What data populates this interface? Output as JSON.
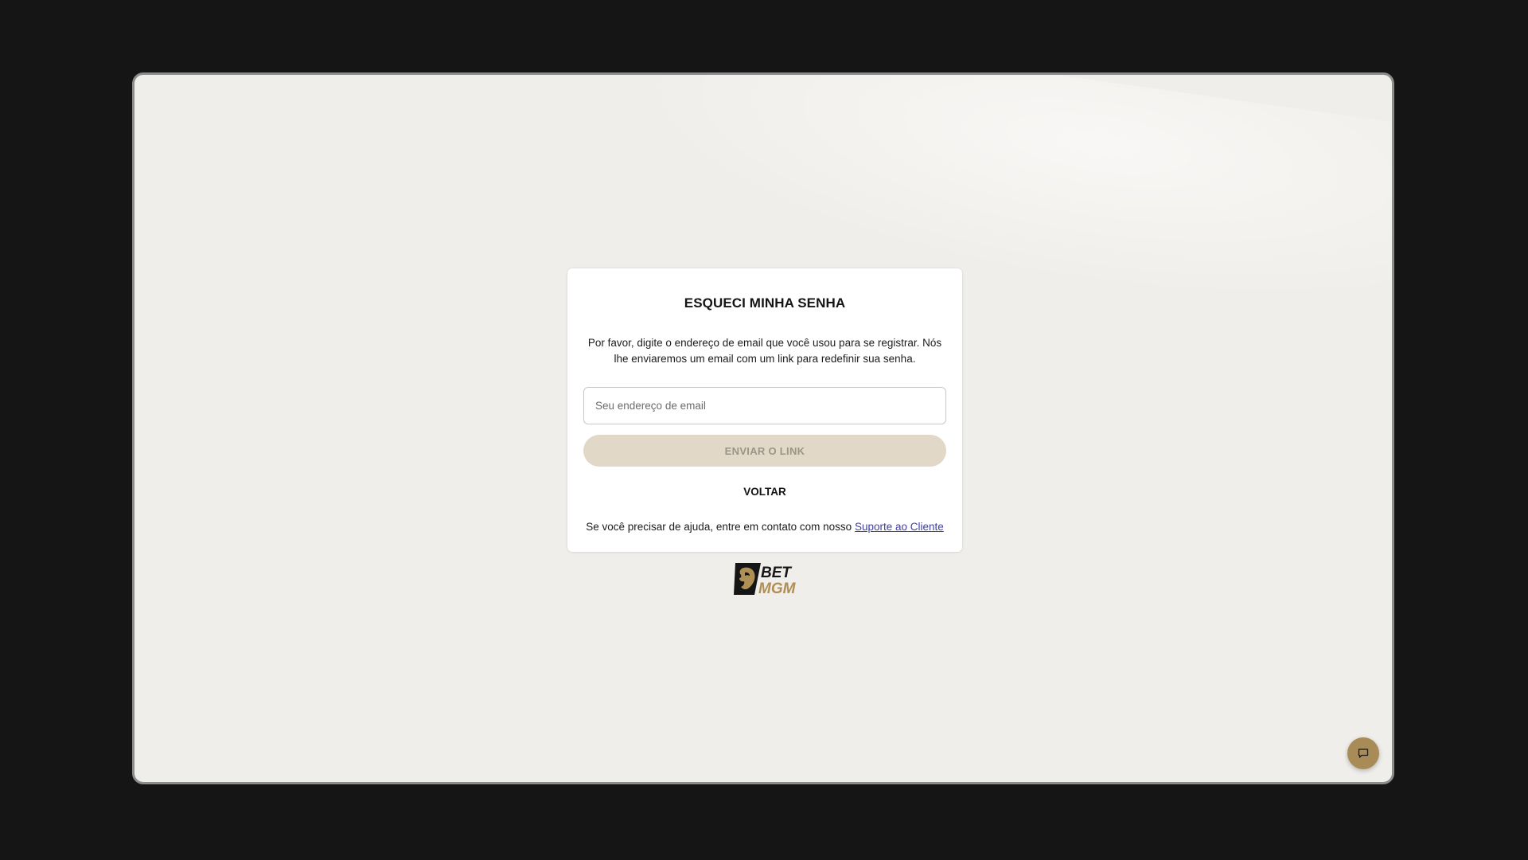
{
  "forgot_password": {
    "title": "ESQUECI MINHA SENHA",
    "description": "Por favor, digite o endereço de email que você usou para se registrar. Nós lhe enviaremos um email com um link para redefinir sua senha.",
    "email_field": {
      "placeholder": "Seu endereço de email",
      "value": ""
    },
    "send_button_label": "ENVIAR O LINK",
    "back_label": "VOLTAR",
    "help_text": "Se você precisar de ajuda, entre em contato com nosso",
    "support_link_label": "Suporte ao Cliente"
  },
  "brand": {
    "logo_text_top": "BET",
    "logo_text_bottom": "MGM",
    "logo_icon": "lion-icon"
  },
  "chat": {
    "icon": "chat-bubble-icon"
  },
  "colors": {
    "page_background": "#f0eeea",
    "accent_gold": "#a98b57",
    "button_disabled": "#e1d8c7",
    "link": "#3d3da8"
  }
}
